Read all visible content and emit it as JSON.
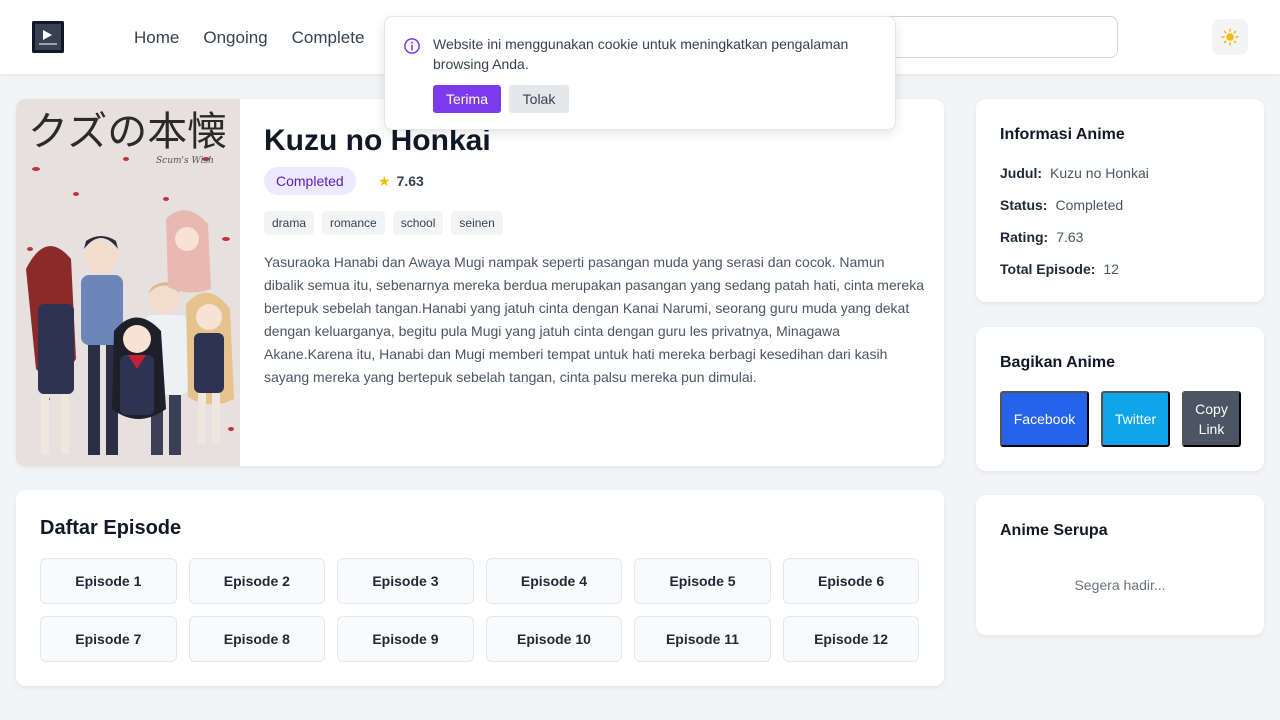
{
  "header": {
    "logo_alt": "Logo",
    "nav": [
      "Home",
      "Ongoing",
      "Complete"
    ],
    "search_placeholder": "",
    "theme_icon": "sun-icon"
  },
  "cookie_banner": {
    "message": "Website ini menggunakan cookie untuk meningkatkan pengalaman browsing Anda.",
    "accept_label": "Terima",
    "reject_label": "Tolak",
    "icon": "info-icon",
    "accent_color": "#7c3aed"
  },
  "anime": {
    "poster_title_jp": "クズの本懐",
    "poster_subtitle": "Scum's Wish",
    "title": "Kuzu no Honkai",
    "status": "Completed",
    "rating": "7.63",
    "genres": [
      "drama",
      "romance",
      "school",
      "seinen"
    ],
    "synopsis": "Yasuraoka Hanabi dan Awaya Mugi nampak seperti pasangan muda yang serasi dan cocok. Namun dibalik semua itu, sebenarnya mereka berdua merupakan pasangan yang sedang patah hati, cinta mereka bertepuk sebelah tangan.Hanabi yang jatuh cinta dengan Kanai Narumi, seorang guru muda yang dekat dengan keluarganya, begitu pula Mugi yang jatuh cinta dengan guru les privatnya, Minagawa Akane.Karena itu, Hanabi dan Mugi memberi tempat untuk hati mereka berbagi kesedihan dari kasih sayang mereka yang bertepuk sebelah tangan, cinta palsu mereka pun dimulai."
  },
  "episodes": {
    "title": "Daftar Episode",
    "items": [
      "Episode 1",
      "Episode 2",
      "Episode 3",
      "Episode 4",
      "Episode 5",
      "Episode 6",
      "Episode 7",
      "Episode 8",
      "Episode 9",
      "Episode 10",
      "Episode 11",
      "Episode 12"
    ]
  },
  "info": {
    "title": "Informasi Anime",
    "rows": [
      {
        "label": "Judul:",
        "value": "Kuzu no Honkai"
      },
      {
        "label": "Status:",
        "value": "Completed"
      },
      {
        "label": "Rating:",
        "value": "7.63"
      },
      {
        "label": "Total Episode:",
        "value": "12"
      }
    ]
  },
  "share": {
    "title": "Bagikan Anime",
    "facebook": "Facebook",
    "twitter": "Twitter",
    "copy": "Copy Link",
    "colors": {
      "facebook": "#2563eb",
      "twitter": "#0ea5e9",
      "copy": "#4b5563"
    }
  },
  "similar": {
    "title": "Anime Serupa",
    "placeholder": "Segera hadir..."
  }
}
